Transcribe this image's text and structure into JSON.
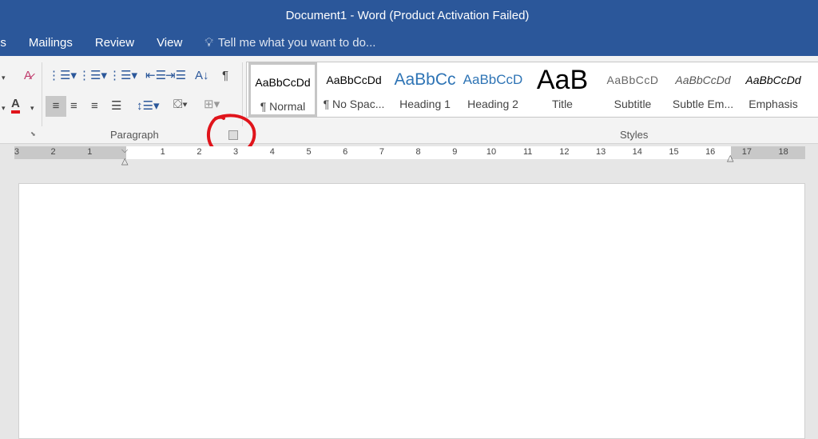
{
  "window": {
    "title": "Document1 - Word (Product Activation Failed)"
  },
  "tabs": [
    {
      "label": "es"
    },
    {
      "label": "Mailings"
    },
    {
      "label": "Review"
    },
    {
      "label": "View"
    }
  ],
  "tell_me": {
    "placeholder": "Tell me what you want to do..."
  },
  "groups": {
    "paragraph": "Paragraph",
    "styles": "Styles"
  },
  "styles": [
    {
      "preview": "AaBbCcDd",
      "name": "¶ Normal",
      "selected": true
    },
    {
      "preview": "AaBbCcDd",
      "name": "¶ No Spac..."
    },
    {
      "preview": "AaBbCc",
      "name": "Heading 1"
    },
    {
      "preview": "AaBbCcD",
      "name": "Heading 2"
    },
    {
      "preview": "AaB",
      "name": "Title"
    },
    {
      "preview": "AaBbCcD",
      "name": "Subtitle"
    },
    {
      "preview": "AaBbCcDd",
      "name": "Subtle Em..."
    },
    {
      "preview": "AaBbCcDd",
      "name": "Emphasis"
    }
  ],
  "ruler": {
    "left": [
      "3",
      "2",
      "1"
    ],
    "right": [
      "1",
      "2",
      "3",
      "4",
      "5",
      "6",
      "7",
      "8",
      "9",
      "10",
      "11",
      "12",
      "13",
      "14",
      "15",
      "16",
      "17",
      "18"
    ]
  },
  "colors": {
    "brand": "#2b579a",
    "annotation": "#e0141b",
    "font_color_bar": "#e0141b"
  }
}
